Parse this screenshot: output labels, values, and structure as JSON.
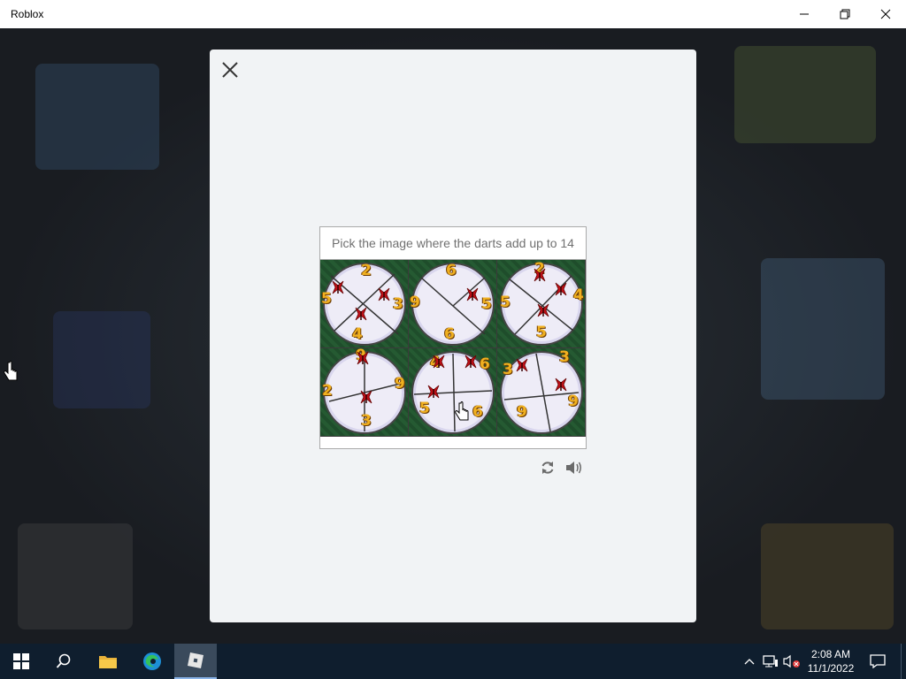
{
  "window": {
    "title": "Roblox"
  },
  "captcha": {
    "prompt": "Pick the image where the darts add up to 14",
    "tiles": [
      {
        "numbers": [
          "2",
          "5",
          "3",
          "4"
        ]
      },
      {
        "numbers": [
          "6",
          "9",
          "5",
          "6"
        ]
      },
      {
        "numbers": [
          "2",
          "5",
          "4",
          "5"
        ]
      },
      {
        "numbers": [
          "9",
          "2",
          "9",
          "3"
        ]
      },
      {
        "numbers": [
          "4",
          "6",
          "5",
          "6"
        ]
      },
      {
        "numbers": [
          "3",
          "3",
          "9",
          "9"
        ]
      }
    ]
  },
  "taskbar": {
    "time": "2:08 AM",
    "date": "11/1/2022"
  },
  "icons": {
    "close": "close-icon",
    "refresh": "refresh-icon",
    "audio": "speaker-icon"
  },
  "colors": {
    "modal_bg": "#f1f3f5",
    "taskbar": "#0f1e2e",
    "number": "#f0b020",
    "dart": "#c01018"
  }
}
